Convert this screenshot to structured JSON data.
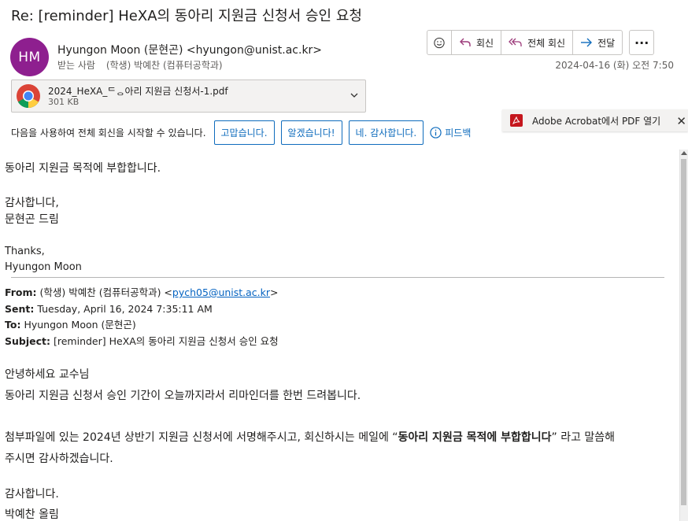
{
  "email": {
    "subject": "Re: [reminder] HeXA의 동아리 지원금 신청서 승인 요청",
    "avatar_initials": "HM",
    "avatar_color": "#8e1f8f",
    "sender_name": "Hyungon Moon (문현곤)",
    "sender_email": "<hyungon@unist.ac.kr>",
    "to_label": "받는 사람",
    "to_value": "(학생) 박예찬 (컴퓨터공학과)",
    "date": "2024-04-16 (화) 오전 7:50"
  },
  "actions": {
    "reply": "회신",
    "reply_all": "전체 회신",
    "forward": "전달",
    "more": "···"
  },
  "attachment": {
    "file_name": "2024_HeXA_ᄃᆼ아리 지원금 신청서-1.pdf",
    "file_size": "301 KB"
  },
  "quick_reply": {
    "hint": "다음을 사용하여 전체 회신을 시작할 수 있습니다.",
    "options": [
      "고맙습니다.",
      "알겠습니다!",
      "네. 감사합니다."
    ],
    "feedback": "피드백"
  },
  "acrobat_banner": {
    "text": "Adobe Acrobat에서 PDF 열기"
  },
  "reply_body": {
    "line1": "동아리 지원금 목적에 부합합니다.",
    "line2": "감사합니다,",
    "line3": "문현곤 드림",
    "line4": "Thanks,",
    "line5": "Hyungon Moon"
  },
  "quoted_header": {
    "from_label": "From:",
    "from_value": "(학생) 박예찬 (컴퓨터공학과) <",
    "from_email": "pych05@unist.ac.kr",
    "from_close": ">",
    "sent_label": "Sent:",
    "sent_value": "Tuesday, April 16, 2024 7:35:11 AM",
    "to_label": "To:",
    "to_value": "Hyungon Moon (문현곤)",
    "subject_label": "Subject:",
    "subject_value": "[reminder] HeXA의 동아리 지원금 신청서 승인 요청"
  },
  "quoted_body": {
    "greeting": "안녕하세요 교수님",
    "line1": "동아리 지원금 신청서 승인 기간이 오늘까지라서 리마인더를 한번 드려봅니다.",
    "line2_a": "첨부파일에 있는 2024년 상반기 지원금 신청서에 서명해주시고, 회신하시는 메일에 “",
    "line2_bold": "동아리 지원금 목적에 부합합니다",
    "line2_b": "” 라고 말씀해",
    "line3": "주시면 감사하겠습니다.",
    "thanks": "감사합니다.",
    "signoff": "박예찬 올림"
  },
  "icons": {
    "emoji": "smiley-icon",
    "reply": "reply-arrow-icon",
    "reply_all": "reply-all-icon",
    "forward": "forward-arrow-icon",
    "attachment": "chrome-file-icon",
    "pdf": "adobe-pdf-icon",
    "info": "info-icon",
    "close": "close-icon"
  }
}
